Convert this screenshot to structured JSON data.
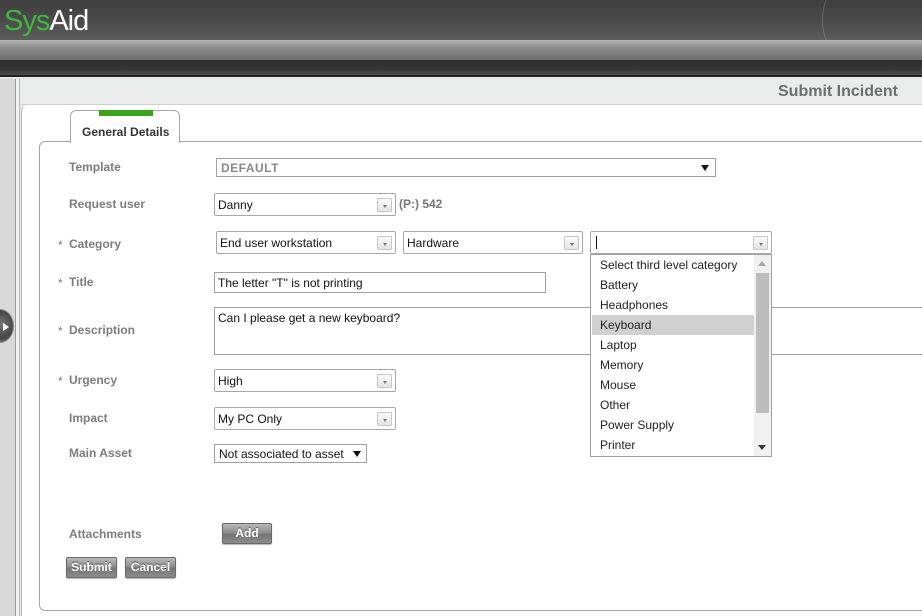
{
  "app": {
    "logo_part1": "Sys",
    "logo_part2": "Aid",
    "brand_color": "#3db83d"
  },
  "page": {
    "title": "Submit Incident"
  },
  "tabs": [
    {
      "label": "General Details",
      "active": true,
      "accent_color": "#3aa51b"
    }
  ],
  "form": {
    "template": {
      "label": "Template",
      "value": "DEFAULT"
    },
    "request_user": {
      "label": "Request user",
      "value": "Danny",
      "phone": "(P:) 542"
    },
    "category": {
      "label": "Category",
      "required_mark": "*",
      "level1": "End user workstation",
      "level2": "Hardware",
      "level3": "",
      "level3_options": [
        "Select third level category",
        "Battery",
        "Headphones",
        "Keyboard",
        "Laptop",
        "Memory",
        "Mouse",
        "Other",
        "Power Supply",
        "Printer"
      ],
      "level3_highlighted": "Keyboard"
    },
    "title": {
      "label": "Title",
      "required_mark": "*",
      "value": "The letter \"T\" is not printing"
    },
    "description": {
      "label": "Description",
      "required_mark": "*",
      "value": "Can I please get a new keyboard?"
    },
    "urgency": {
      "label": "Urgency",
      "required_mark": "*",
      "value": "High"
    },
    "impact": {
      "label": "Impact",
      "value": "My PC Only"
    },
    "main_asset": {
      "label": "Main Asset",
      "value": "Not associated to asset"
    },
    "attachments": {
      "label": "Attachments",
      "add_label": "Add"
    }
  },
  "actions": {
    "submit_label": "Submit",
    "cancel_label": "Cancel"
  }
}
